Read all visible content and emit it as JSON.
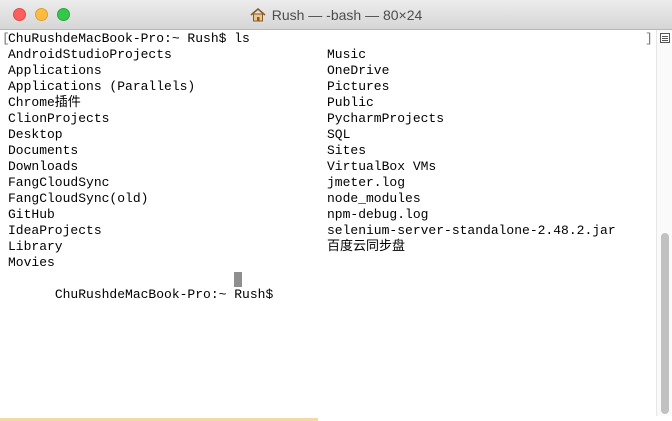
{
  "window": {
    "title": "Rush — -bash — 80×24",
    "title_icon": "home-icon"
  },
  "terminal": {
    "prompt_line": "ChuRushdeMacBook-Pro:~ Rush$ ls",
    "col1": [
      "AndroidStudioProjects",
      "Applications",
      "Applications (Parallels)",
      "Chrome插件",
      "ClionProjects",
      "Desktop",
      "Documents",
      "Downloads",
      "FangCloudSync",
      "FangCloudSync(old)",
      "GitHub",
      "IdeaProjects",
      "Library",
      "Movies"
    ],
    "col2": [
      "Music",
      "OneDrive",
      "Pictures",
      "Public",
      "PycharmProjects",
      "SQL",
      "Sites",
      "VirtualBox VMs",
      "jmeter.log",
      "node_modules",
      "npm-debug.log",
      "selenium-server-standalone-2.48.2.jar",
      "百度云同步盘"
    ],
    "final_prompt": "ChuRushdeMacBook-Pro:~ Rush$ "
  },
  "colors": {
    "close": "#fc605c",
    "minimize": "#fdbc40",
    "zoom": "#34c84a"
  }
}
